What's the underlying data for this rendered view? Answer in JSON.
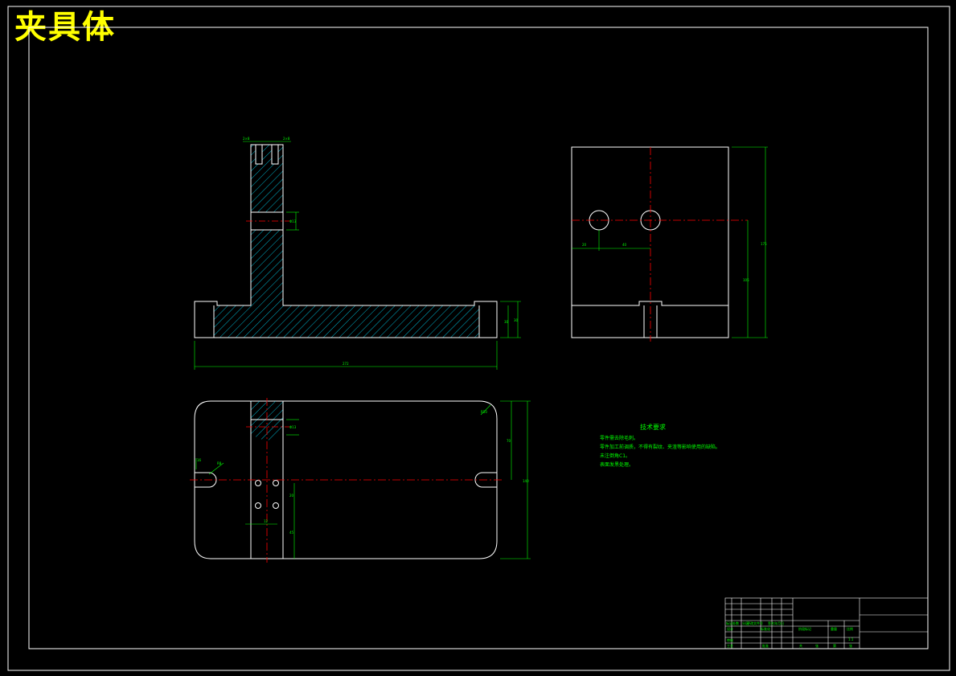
{
  "title": "夹具体",
  "colors": {
    "background": "#000000",
    "outline": "#ffffff",
    "dimension": "#00ff00",
    "centerline": "#ff0000",
    "title": "#ffff00"
  },
  "tech_requirements": {
    "heading": "技术要求",
    "lines": [
      "零件需去除毛刺。",
      "零件加工前调质，不得有裂纹、夹渣等影响使用的缺陷。",
      "未注倒角C1。",
      "表面发黑处理。"
    ]
  },
  "dimensions": {
    "total_length": "272",
    "base_height_1": "30",
    "base_height_2": "30",
    "upright_hole": "Φ13",
    "top_slot_left": "2×8",
    "top_slot_right": "2×8",
    "side_height": "175",
    "side_hole_height": "105",
    "side_hole_spacing_1": "20",
    "side_hole_spacing_2": "40",
    "plan_width": "140",
    "plan_upper": "70",
    "plan_radius": "R10",
    "plan_slot_width": "16",
    "plan_slot_radius": "R8",
    "plan_hole_spacing_v": "20",
    "plan_hole_spacing_h": "12",
    "plan_lower": "45",
    "plan_bore": "Φ13"
  },
  "title_block": {
    "row_labels": [
      "标记",
      "处数",
      "分区",
      "更改文件号",
      "签名",
      "年月日"
    ],
    "sub_labels": [
      "设计",
      "标准化",
      "审核",
      "工艺",
      "批准"
    ],
    "stage_labels": [
      "阶段标记",
      "重量",
      "比例"
    ],
    "sheet_labels": [
      "共",
      "张",
      "第",
      "张"
    ],
    "scale": "1:1"
  }
}
